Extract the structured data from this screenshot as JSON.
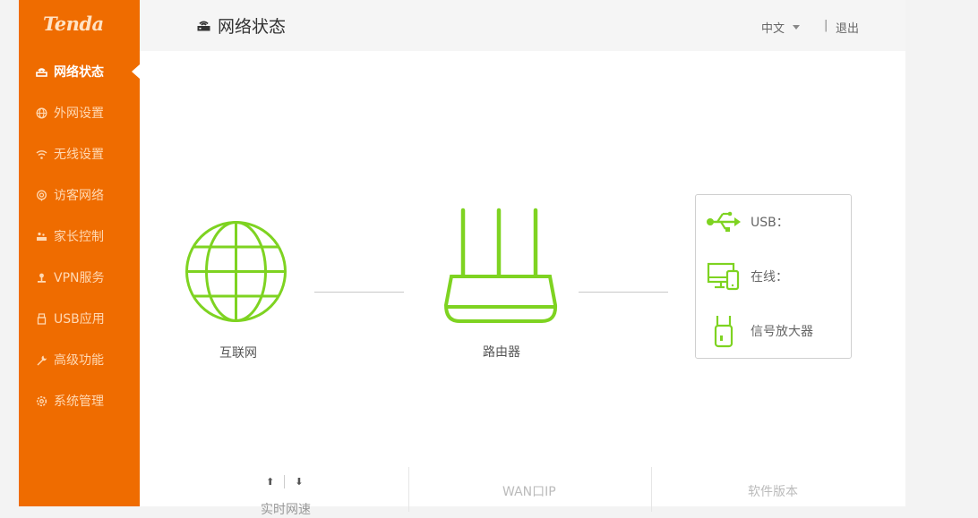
{
  "brand": {
    "logo_text": "Tenda"
  },
  "sidebar": {
    "items": [
      {
        "label": "网络状态",
        "icon": "router-icon",
        "active": true
      },
      {
        "label": "外网设置",
        "icon": "globe-icon"
      },
      {
        "label": "无线设置",
        "icon": "wifi-icon"
      },
      {
        "label": "访客网络",
        "icon": "guest-icon"
      },
      {
        "label": "家长控制",
        "icon": "parental-icon"
      },
      {
        "label": "VPN服务",
        "icon": "vpn-icon"
      },
      {
        "label": "USB应用",
        "icon": "usb-icon"
      },
      {
        "label": "高级功能",
        "icon": "wrench-icon"
      },
      {
        "label": "系统管理",
        "icon": "gear-icon"
      }
    ]
  },
  "header": {
    "title": "网络状态",
    "language": "中文",
    "separator": "|",
    "logout_label": "退出"
  },
  "topology": {
    "internet_label": "互联网",
    "router_label": "路由器",
    "status": {
      "usb_label": "USB：",
      "online_label": "在线：",
      "extender_label": "信号放大器"
    }
  },
  "bottom": {
    "upload_arrow": "⬆",
    "download_arrow": "⬇",
    "realtime_label": "实时网速",
    "wan_ip_label": "WAN口IP",
    "firmware_label": "软件版本"
  },
  "colors": {
    "sidebar": "#ef6c00",
    "accent_green": "#7ed321",
    "header_bg": "#f5f5f5"
  }
}
